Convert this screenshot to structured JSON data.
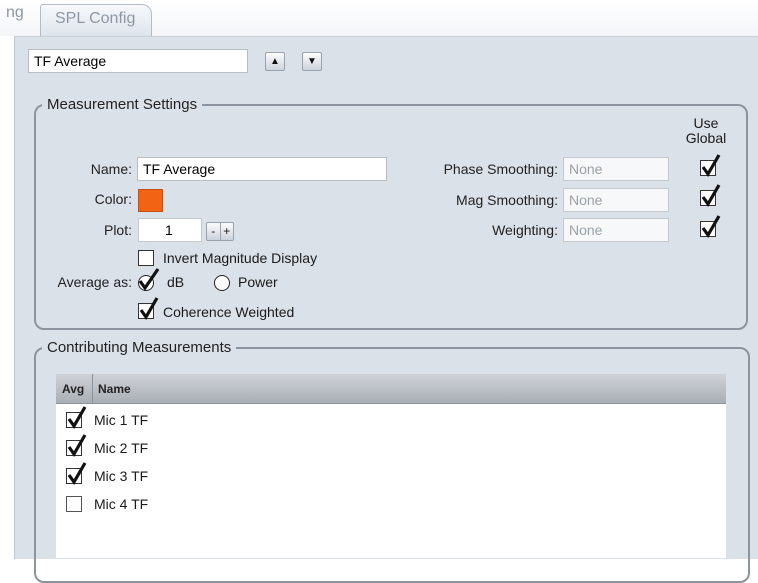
{
  "tabs": {
    "prev_label": "ng",
    "active_label": "SPL Config"
  },
  "selector": {
    "value": "TF Average",
    "up_glyph": "▲",
    "down_glyph": "▼"
  },
  "measurement_settings": {
    "legend": "Measurement Settings",
    "use_global_line1": "Use",
    "use_global_line2": "Global",
    "name_label": "Name:",
    "name_value": "TF Average",
    "color_label": "Color:",
    "color_value": "#f26414",
    "plot_label": "Plot:",
    "plot_value": "1",
    "plot_minus": "-",
    "plot_plus": "+",
    "invert_label": "Invert Magnitude Display",
    "invert_checked": false,
    "average_as_label": "Average as:",
    "avg_db_label": "dB",
    "avg_power_label": "Power",
    "avg_selected": "dB",
    "coherence_label": "Coherence Weighted",
    "coherence_checked": true,
    "phase_smoothing_label": "Phase Smoothing:",
    "phase_smoothing_value": "None",
    "phase_smoothing_global": true,
    "mag_smoothing_label": "Mag Smoothing:",
    "mag_smoothing_value": "None",
    "mag_smoothing_global": true,
    "weighting_label": "Weighting:",
    "weighting_value": "None",
    "weighting_global": true
  },
  "contributing": {
    "legend": "Contributing Measurements",
    "columns": [
      "Avg",
      "Name"
    ],
    "rows": [
      {
        "checked": true,
        "name": "Mic 1 TF"
      },
      {
        "checked": true,
        "name": "Mic 2 TF"
      },
      {
        "checked": true,
        "name": "Mic 3 TF"
      },
      {
        "checked": false,
        "name": "Mic 4 TF"
      }
    ]
  },
  "colors": {
    "accent_orange": "#f26414",
    "panel_bg": "#dbe1e9",
    "frame_border": "#8c949f"
  }
}
